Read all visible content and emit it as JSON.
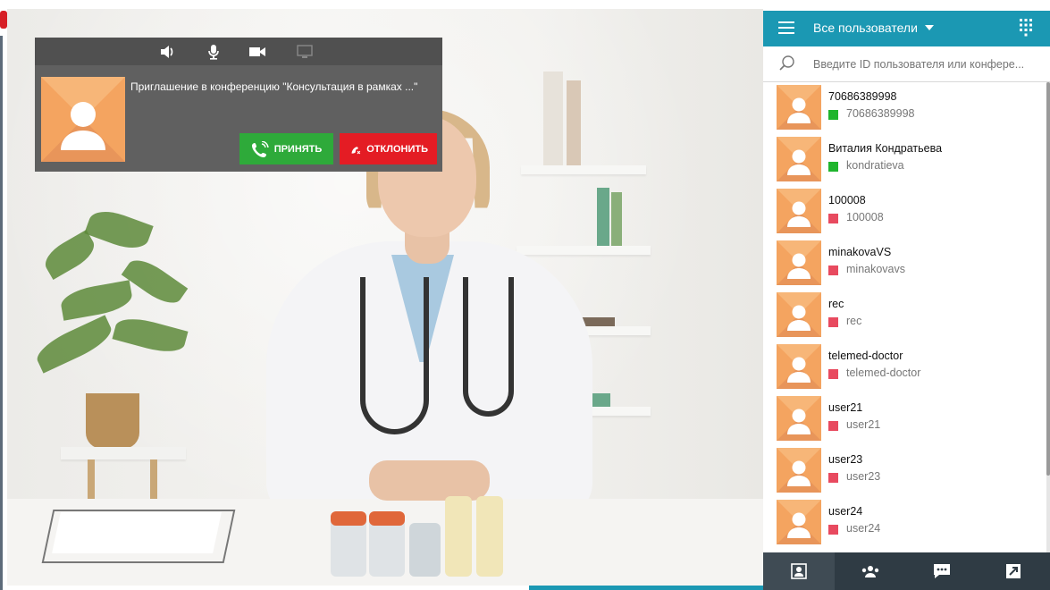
{
  "notification": {
    "message": "Приглашение в конференцию \"Консультация в рамках ...\"",
    "accept_label": "ПРИНЯТЬ",
    "decline_label": "ОТКЛОНИТЬ",
    "toolbar_icons": [
      "speaker-icon",
      "microphone-icon",
      "camera-icon",
      "screen-share-icon"
    ]
  },
  "panel": {
    "title": "Все пользователи",
    "search_placeholder": "Введите ID пользователя или конфере...",
    "users": [
      {
        "name": "70686389998",
        "login": "70686389998",
        "status": "online",
        "status_color": "#1fb52d"
      },
      {
        "name": "Виталия Кондратьева",
        "login": "kondratieva",
        "status": "online",
        "status_color": "#1fb52d"
      },
      {
        "name": "100008",
        "login": "100008",
        "status": "offline",
        "status_color": "#e84a5f"
      },
      {
        "name": "minakovaVS",
        "login": "minakovavs",
        "status": "offline",
        "status_color": "#e84a5f"
      },
      {
        "name": "rec",
        "login": "rec",
        "status": "offline",
        "status_color": "#e84a5f"
      },
      {
        "name": "telemed-doctor",
        "login": "telemed-doctor",
        "status": "offline",
        "status_color": "#e84a5f"
      },
      {
        "name": "user21",
        "login": "user21",
        "status": "offline",
        "status_color": "#e84a5f"
      },
      {
        "name": "user23",
        "login": "user23",
        "status": "offline",
        "status_color": "#e84a5f"
      },
      {
        "name": "user24",
        "login": "user24",
        "status": "offline",
        "status_color": "#e84a5f"
      }
    ],
    "bottom_tabs": [
      "contacts-icon",
      "group-icon",
      "chat-icon",
      "call-history-icon"
    ]
  },
  "colors": {
    "accent": "#1b98b3",
    "accept": "#2eaa3a",
    "decline": "#e41c24",
    "avatar_bg": "#f4a460"
  }
}
